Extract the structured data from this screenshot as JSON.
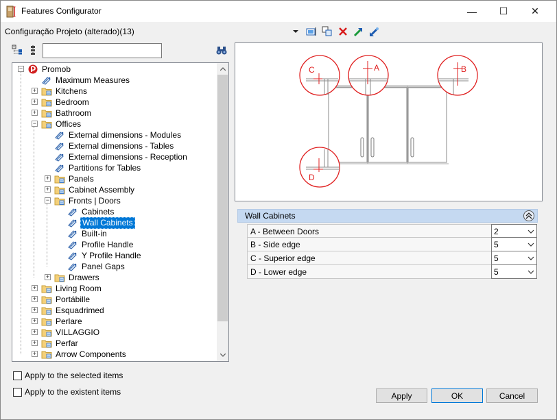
{
  "window": {
    "title": "Features Configurator",
    "minimize": "—",
    "maximize": "☐",
    "close": "✕"
  },
  "config_label": "Configuração Projeto (alterado)(13)",
  "toolbar": {
    "icons": [
      "dropdown-arrow-icon",
      "select-icon",
      "copy-icon",
      "delete-icon",
      "import-icon",
      "export-icon"
    ]
  },
  "search": {
    "value": "",
    "placeholder": ""
  },
  "tree": {
    "root": "Promob",
    "items": [
      {
        "label": "Maximum Measures",
        "type": "item"
      },
      {
        "label": "Kitchens",
        "type": "folder"
      },
      {
        "label": "Bedroom",
        "type": "folder"
      },
      {
        "label": "Bathroom",
        "type": "folder"
      },
      {
        "label": "Offices",
        "type": "folder-open"
      },
      {
        "label": "External dimensions - Modules",
        "type": "item"
      },
      {
        "label": "External dimensions - Tables",
        "type": "item"
      },
      {
        "label": "External dimensions - Reception",
        "type": "item"
      },
      {
        "label": "Partitions for Tables",
        "type": "item"
      },
      {
        "label": "Panels",
        "type": "folder"
      },
      {
        "label": "Cabinet Assembly",
        "type": "folder"
      },
      {
        "label": "Fronts | Doors",
        "type": "folder-open"
      },
      {
        "label": "Cabinets",
        "type": "item"
      },
      {
        "label": "Wall Cabinets",
        "type": "item",
        "selected": true
      },
      {
        "label": "Built-in",
        "type": "item"
      },
      {
        "label": "Profile Handle",
        "type": "item"
      },
      {
        "label": "Y Profile Handle",
        "type": "item"
      },
      {
        "label": "Panel Gaps",
        "type": "item"
      },
      {
        "label": "Drawers",
        "type": "folder"
      },
      {
        "label": "Living Room",
        "type": "folder"
      },
      {
        "label": "Portábille",
        "type": "folder"
      },
      {
        "label": "Esquadrimed",
        "type": "folder"
      },
      {
        "label": "Perlare",
        "type": "folder"
      },
      {
        "label": "VILLAGGIO",
        "type": "folder"
      },
      {
        "label": "Perfar",
        "type": "folder"
      },
      {
        "label": "Arrow Components",
        "type": "folder"
      }
    ]
  },
  "preview": {
    "labels": {
      "a": "A",
      "b": "B",
      "c": "C",
      "d": "D"
    },
    "accent": "#e02020"
  },
  "properties": {
    "title": "Wall Cabinets",
    "rows": [
      {
        "label": "A - Between Doors",
        "value": "2"
      },
      {
        "label": "B - Side edge",
        "value": "5"
      },
      {
        "label": "C - Superior edge",
        "value": "5"
      },
      {
        "label": "D - Lower edge",
        "value": "5"
      }
    ]
  },
  "options": {
    "apply_selected": "Apply to the selected items",
    "apply_existent": "Apply to the existent items"
  },
  "buttons": {
    "apply": "Apply",
    "ok": "OK",
    "cancel": "Cancel"
  }
}
